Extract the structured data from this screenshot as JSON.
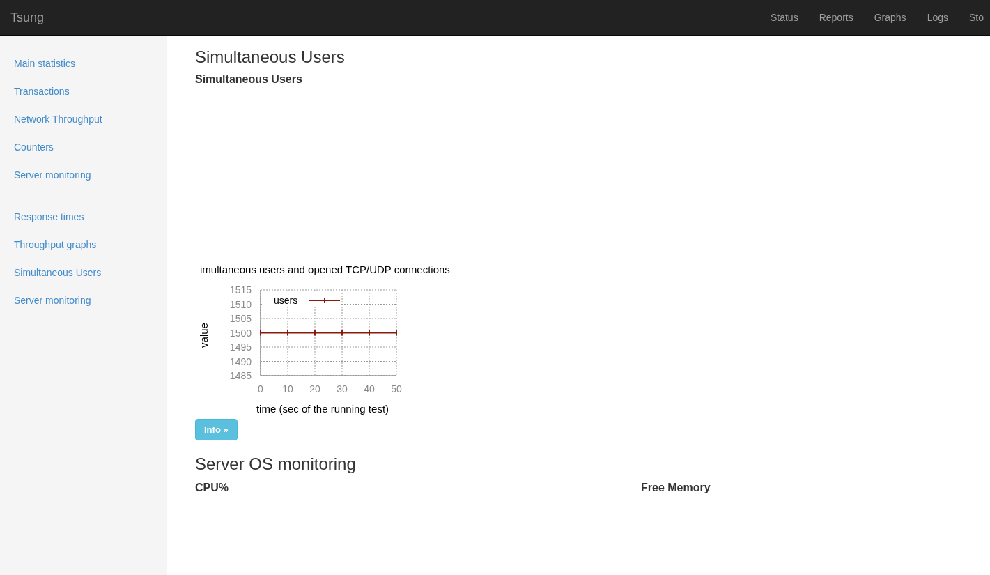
{
  "navbar": {
    "brand": "Tsung",
    "links": [
      {
        "label": "Status"
      },
      {
        "label": "Reports"
      },
      {
        "label": "Graphs"
      },
      {
        "label": "Logs"
      },
      {
        "label": "Sto"
      }
    ]
  },
  "sidebar": {
    "groups": [
      {
        "items": [
          {
            "label": "Main statistics"
          },
          {
            "label": "Transactions"
          },
          {
            "label": "Network Throughput"
          },
          {
            "label": "Counters"
          },
          {
            "label": "Server monitoring"
          }
        ]
      },
      {
        "items": [
          {
            "label": "Response times"
          },
          {
            "label": "Throughput graphs"
          },
          {
            "label": "Simultaneous Users"
          },
          {
            "label": "Server monitoring"
          }
        ]
      }
    ]
  },
  "main": {
    "title": "Simultaneous Users",
    "subtitle": "Simultaneous Users",
    "chart": {
      "chart_data": {
        "type": "line",
        "title": "imultaneous users and opened TCP/UDP connections",
        "xlabel": "time (sec of the running test)",
        "ylabel": "value",
        "x": [
          0,
          10,
          20,
          30,
          40,
          50
        ],
        "series": [
          {
            "name": "users",
            "color": "#8b1a0e",
            "values": [
              1500,
              1500,
              1500,
              1500,
              1500,
              1500
            ]
          }
        ],
        "grid": true,
        "xlim": [
          0,
          50
        ],
        "ylim": [
          1485,
          1515
        ],
        "xticks": [
          0,
          10,
          20,
          30,
          40,
          50
        ],
        "yticks": [
          1485,
          1490,
          1495,
          1500,
          1505,
          1510,
          1515
        ]
      }
    },
    "info_button": "Info »",
    "section": {
      "title": "Server OS monitoring",
      "columns": [
        {
          "heading": "CPU%"
        },
        {
          "heading": "Free Memory"
        }
      ]
    }
  }
}
